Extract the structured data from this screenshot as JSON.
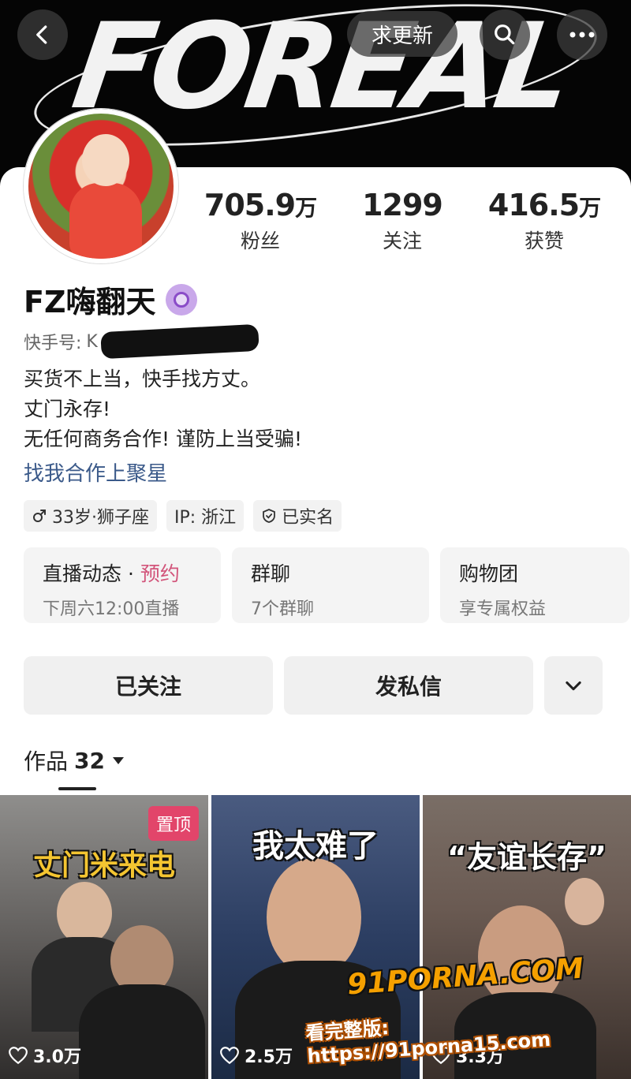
{
  "banner": {
    "word": "FOREAL"
  },
  "topbar": {
    "update_label": "求更新"
  },
  "profile": {
    "name": "FZ嗨翻天",
    "kuaishou_label": "快手号:",
    "kuaishou_id_visible": "K",
    "bio": [
      "买货不上当，快手找方丈。",
      "丈门永存!",
      "无任何商务合作! 谨防上当受骗!"
    ],
    "bio_link": "找我合作上聚星"
  },
  "stats": [
    {
      "num": "705.9",
      "unit": "万",
      "label": "粉丝"
    },
    {
      "num": "1299",
      "unit": "",
      "label": "关注"
    },
    {
      "num": "416.5",
      "unit": "万",
      "label": "获赞"
    }
  ],
  "tags": {
    "age": "33岁·狮子座",
    "ip": "IP: 浙江",
    "verified": "已实名"
  },
  "info_cards": [
    {
      "title": "直播动态 · ",
      "accent": "预约",
      "sub": "下周六12:00直播"
    },
    {
      "title": "群聊",
      "accent": "",
      "sub": "7个群聊"
    },
    {
      "title": "购物团",
      "accent": "",
      "sub": "享专属权益"
    }
  ],
  "actions": {
    "follow": "已关注",
    "message": "发私信"
  },
  "works": {
    "label": "作品",
    "count": "32"
  },
  "videos": [
    {
      "caption": "丈门米来电",
      "pin": "置顶",
      "likes": "3.0万"
    },
    {
      "caption": "我太难了",
      "pin": "",
      "likes": "2.5万"
    },
    {
      "caption": "“友谊长存”",
      "pin": "",
      "likes": "3.3万"
    }
  ],
  "watermark": {
    "line1": "91PORNA.COM",
    "line2": "看完整版: https://91porna15.com"
  },
  "colors": {
    "accent": "#d2547a",
    "link": "#3b5a8a",
    "pin": "#e2456a",
    "watermark": "#f5a000"
  }
}
